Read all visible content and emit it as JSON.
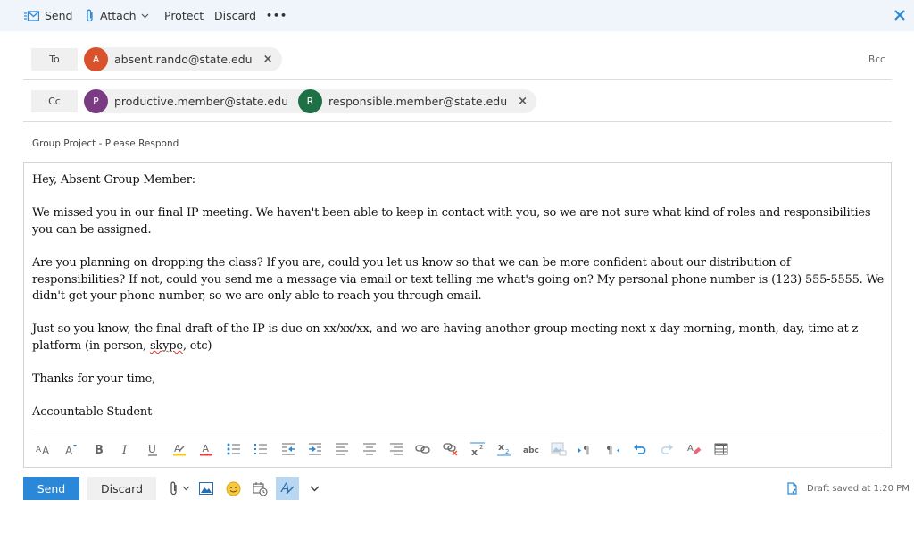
{
  "toolbar": {
    "send_label": "Send",
    "attach_label": "Attach",
    "protect_label": "Protect",
    "discard_label": "Discard",
    "more_label": "•••",
    "close_icon": "close-icon"
  },
  "recipients": {
    "to_label": "To",
    "cc_label": "Cc",
    "bcc_label": "Bcc",
    "to": [
      {
        "initial": "A",
        "email": "absent.rando@state.edu",
        "color": "#d9522c"
      }
    ],
    "cc": [
      {
        "initial": "P",
        "email": "productive.member@state.edu",
        "color": "#7a3b82"
      },
      {
        "initial": "R",
        "email": "responsible.member@state.edu",
        "color": "#1e7145"
      }
    ],
    "remove_glyph": "×"
  },
  "subject": "Group Project - Please Respond",
  "body": {
    "greeting": "Hey, Absent Group Member:",
    "p1": "We missed you in our final IP meeting. We haven't been able to keep in contact with you, so we are not sure what kind of roles and responsibilities you can be assigned.",
    "p2": "Are you planning on dropping the class? If you are, could you let us know so that we can be more confident about our distribution of responsibilities? If not, could you send me a message via email or text telling me what's going on? My personal phone number is (123) 555-5555. We didn't get your phone number, so we are only able to reach you through email.",
    "p3_before": "Just so you know, the final draft of the IP is due on xx/xx/xx, and we are having another group meeting next x-day morning, month, day, time at z-platform (in-person, ",
    "p3_misspelled": "skype",
    "p3_after": ", etc)",
    "closing": "Thanks for your time,",
    "signature": "Accountable Student"
  },
  "format_tools": [
    "font-size-icon",
    "grow-font-icon",
    "bold-icon",
    "italic-icon",
    "underline-icon",
    "highlight-icon",
    "font-color-icon",
    "bullets-icon",
    "numbering-icon",
    "decrease-indent-icon",
    "increase-indent-icon",
    "align-left-icon",
    "align-center-icon",
    "align-right-icon",
    "insert-link-icon",
    "remove-link-icon",
    "superscript-icon",
    "subscript-icon",
    "strikethrough-icon",
    "insert-picture-icon",
    "ltr-icon",
    "rtl-icon",
    "undo-icon",
    "redo-icon",
    "clear-formatting-icon",
    "insert-table-icon"
  ],
  "bottom": {
    "send_label": "Send",
    "discard_label": "Discard",
    "draft_status": "Draft saved at 1:20 PM"
  },
  "colors": {
    "accent": "#2b88d8",
    "topbar_bg": "#f0f5fb",
    "highlight_yellow": "#f2c811",
    "font_red": "#e03c3c"
  }
}
